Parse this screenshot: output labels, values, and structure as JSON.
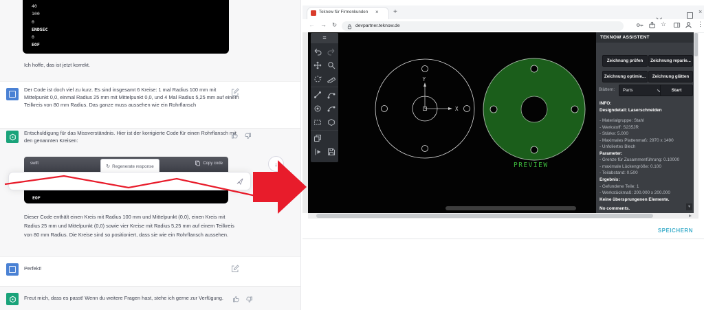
{
  "chat": {
    "code_top_lines": [
      "40",
      "100",
      "0",
      "ENDSEC",
      "0",
      "EOF"
    ],
    "hope_text": "Ich hoffe, das ist jetzt korrekt.",
    "user_msg1": "Der Code ist doch viel zu kurz. Es sind insgesamt 6 Kreise: 1 mal Radius 100 mm mit Mittelpunkt 0,0, einmal Radius 25 mm mit Mittelpunkt 0,0, und 4 Mal Radius 5,25 mm auf einem Teilkreis von 80 mm Radius. Das ganze muss aussehen wie ein Rohrflansch",
    "assistant_msg1": "Entschuldigung für das Missverständnis. Hier ist der korrigierte Code für einen Rohrflansch mit den genannten Kreisen:",
    "code_lang": "swift",
    "copy_code_label": "Copy code",
    "regenerate_label": "Regenerate response",
    "code_bottom_visible": "EOF",
    "assistant_msg2": "Dieser Code enthält einen Kreis mit Radius 100 mm und Mittelpunkt (0,0), einen Kreis mit Radius 25 mm und Mittelpunkt (0,0) sowie vier Kreise mit Radius 5,25 mm auf einem Teilkreis von 80 mm Radius. Die Kreise sind so positioniert, dass sie wie ein Rohrflansch aussehen.",
    "user_msg2": "Perfekt!",
    "assistant_msg3": "Freut mich, dass es passt! Wenn du weitere Fragen hast, stehe ich gerne zur Verfügung."
  },
  "browser": {
    "tab_title": "Teknow für Firmenkunden",
    "url": "devpartner.teknow.de"
  },
  "viewer": {
    "axis_x_label": "X",
    "axis_y_label": "Y",
    "preview_label": "PREVIEW"
  },
  "panel": {
    "title": "TEKNOW ASSISTENT",
    "buttons": [
      "Zeichnung prüfen",
      "Zeichnung reparie...",
      "Zeichnung optimie...",
      "Zeichnung glätten"
    ],
    "browse_label": "Blättern:",
    "browse_value": "Parts",
    "start_label": "Start",
    "lines": [
      "INFO:",
      "Designdetail: Laserschneiden",
      "- Materialgruppe: Stahl",
      "- Werkstoff: S235JR",
      "- Stärke: 5.000",
      "- Maximales Plattenmaß: 2970 x 1490",
      "- Unfoliertes Blech",
      "Parameter:",
      "- Grenze für Zusammenführung: 0.10000",
      "- maximale Lückengröße: 0.100",
      "- Teilabstand: 0.500",
      "Ergebnis:",
      "- Gefundene Teile: 1",
      "- Werkstückmaß: 200.000 x 200.000",
      "Keine übersprungenen Elemente.",
      "No comments."
    ],
    "save_label": "SPEICHERN"
  },
  "colors": {
    "accent_red": "#e81c2b",
    "flange_green": "#1b5e1b",
    "preview_green": "#3db93d",
    "save_blue": "#45b1cd",
    "assistant_green": "#1aa37a",
    "user_blue": "#4a81d4"
  }
}
